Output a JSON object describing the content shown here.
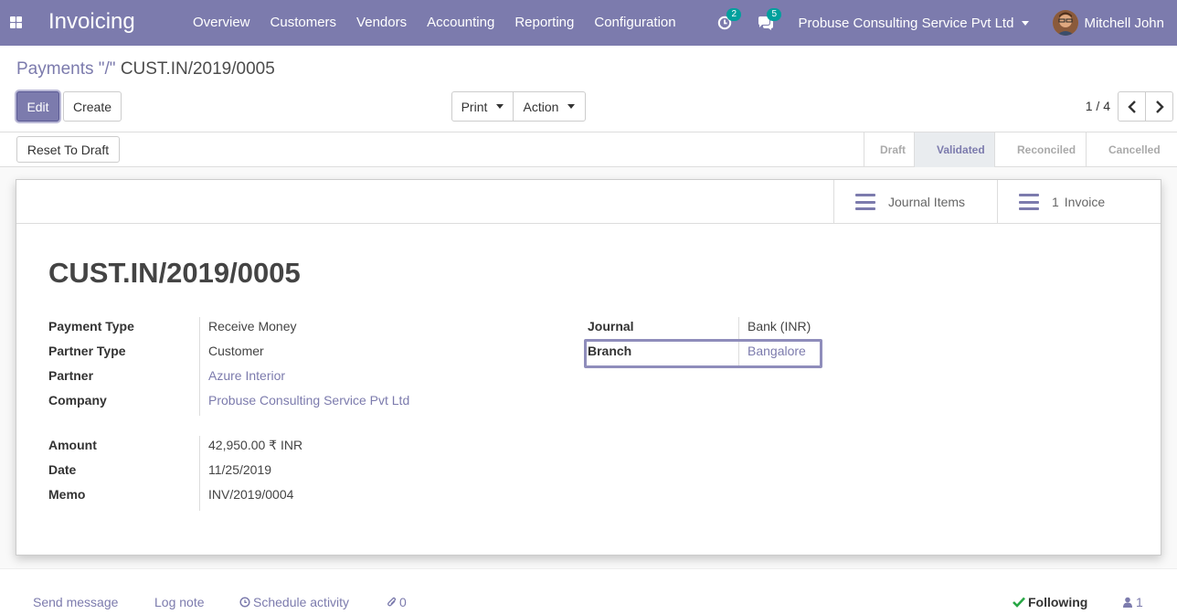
{
  "navbar": {
    "app_name": "Invoicing",
    "menu": [
      "Overview",
      "Customers",
      "Vendors",
      "Accounting",
      "Reporting",
      "Configuration"
    ],
    "activity_count": "2",
    "messages_count": "5",
    "company": "Probuse Consulting Service Pvt Ltd",
    "user": "Mitchell John",
    "color": "#7c7bad"
  },
  "breadcrumb": {
    "parent": "Payments",
    "separator": " \"/\" ",
    "current": "CUST.IN/2019/0005"
  },
  "toolbar": {
    "edit_label": "Edit",
    "create_label": "Create",
    "print_label": "Print",
    "action_label": "Action",
    "pager": "1 / 4"
  },
  "statusbar": {
    "reset_label": "Reset To Draft",
    "steps": [
      "Draft",
      "Validated",
      "Reconciled",
      "Cancelled"
    ],
    "active": "Validated"
  },
  "smart_buttons": {
    "journal_items": "Journal Items",
    "invoice_count": "1",
    "invoice_label": "Invoice"
  },
  "record": {
    "title": "CUST.IN/2019/0005",
    "fields_left": [
      {
        "label": "Payment Type",
        "value": "Receive Money",
        "link": false
      },
      {
        "label": "Partner Type",
        "value": "Customer",
        "link": false
      },
      {
        "label": "Partner",
        "value": "Azure Interior",
        "link": true
      },
      {
        "label": "Company",
        "value": "Probuse Consulting Service Pvt Ltd",
        "link": true
      }
    ],
    "fields_left2": [
      {
        "label": "Amount",
        "value": "42,950.00 ₹ INR",
        "link": false
      },
      {
        "label": "Date",
        "value": "11/25/2019",
        "link": false
      },
      {
        "label": "Memo",
        "value": "INV/2019/0004",
        "link": false
      }
    ],
    "fields_right": [
      {
        "label": "Journal",
        "value": "Bank (INR)",
        "link": false
      },
      {
        "label": "Branch",
        "value": "Bangalore",
        "link": true
      }
    ]
  },
  "chatter": {
    "send_message": "Send message",
    "log_note": "Log note",
    "schedule_activity": "Schedule activity",
    "attachments": "0",
    "following": "Following",
    "followers": "1"
  }
}
